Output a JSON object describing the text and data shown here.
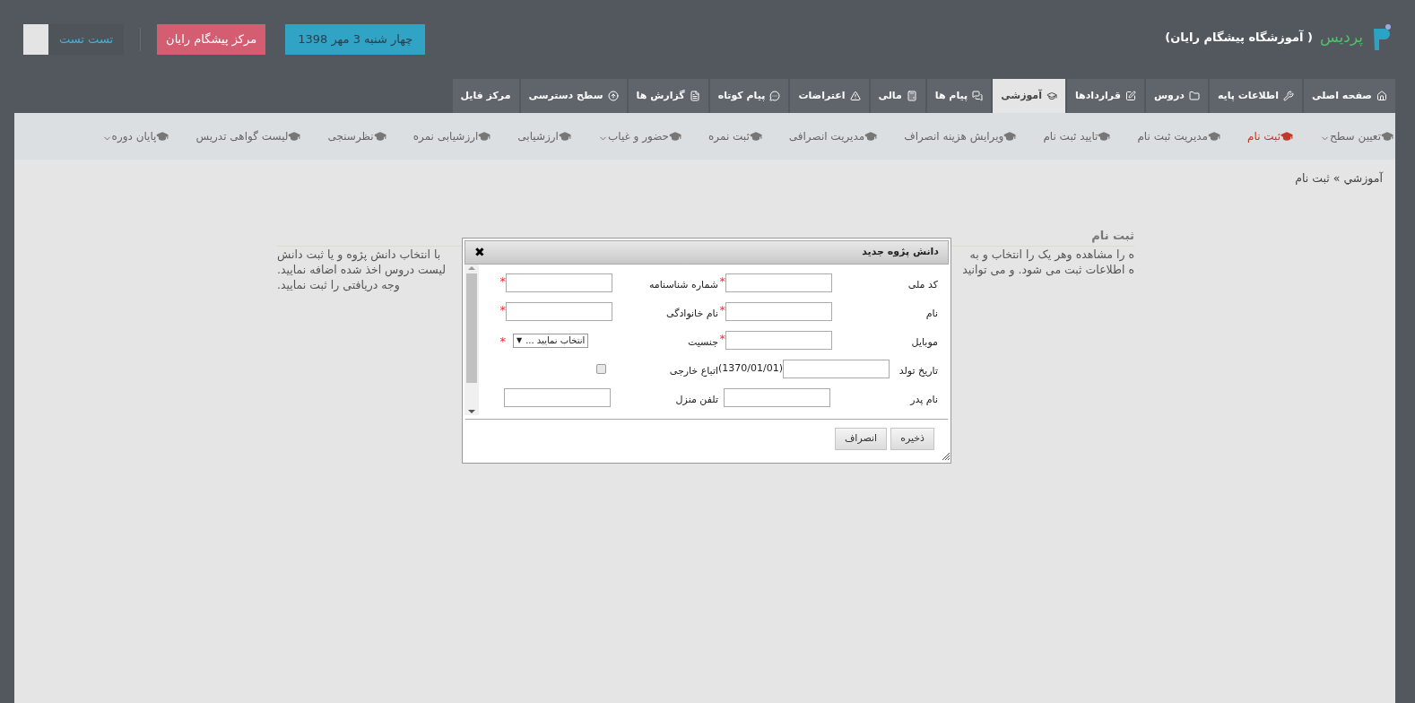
{
  "header": {
    "brand": "پردیس",
    "institute": "( آموزشگاه پیشگام رایان)",
    "date_badge": "چهار شنبه 3 مهر 1398",
    "center_badge": "مرکز پیشگام رایان",
    "user_name": "تست تست"
  },
  "tabs": [
    {
      "label": "صفحه اصلی",
      "selected": false
    },
    {
      "label": "اطلاعات پایه",
      "selected": false
    },
    {
      "label": "دروس",
      "selected": false
    },
    {
      "label": "قراردادها",
      "selected": false
    },
    {
      "label": "آموزشی",
      "selected": true
    },
    {
      "label": "پیام ها",
      "selected": false
    },
    {
      "label": "مالی",
      "selected": false
    },
    {
      "label": "اعتراضات",
      "selected": false
    },
    {
      "label": "پیام کوتاه",
      "selected": false
    },
    {
      "label": "گزارش ها",
      "selected": false
    },
    {
      "label": "سطح دسترسی",
      "selected": false
    },
    {
      "label": "مرکز فایل",
      "selected": false
    }
  ],
  "subnav": [
    {
      "label": "تعیین سطح",
      "selected": false,
      "dropdown": true
    },
    {
      "label": "ثبت نام",
      "selected": true,
      "dropdown": false
    },
    {
      "label": "مدیریت ثبت نام",
      "selected": false,
      "dropdown": false
    },
    {
      "label": "تایید ثبت نام",
      "selected": false,
      "dropdown": false
    },
    {
      "label": "ویرایش هزینه انصراف",
      "selected": false,
      "dropdown": false
    },
    {
      "label": "مدیریت انصرافی",
      "selected": false,
      "dropdown": false
    },
    {
      "label": "ثبت نمره",
      "selected": false,
      "dropdown": false
    },
    {
      "label": "حضور و غیاب",
      "selected": false,
      "dropdown": true
    },
    {
      "label": "ارزشیابی",
      "selected": false,
      "dropdown": false
    },
    {
      "label": "ارزشیابی نمره",
      "selected": false,
      "dropdown": false
    },
    {
      "label": "نظرسنجی",
      "selected": false,
      "dropdown": false
    },
    {
      "label": "لیست گواهی تدریس",
      "selected": false,
      "dropdown": false
    },
    {
      "label": "پایان دوره",
      "selected": false,
      "dropdown": true
    }
  ],
  "breadcrumb": "آموزشي » ثبت نام",
  "section": {
    "title": "ثبت نام",
    "lines": [
      {
        "left": "با انتخاب دانش پژوه و یا ثبت دانش",
        "right": "ه را مشاهده وهر یک را انتخاب و به"
      },
      {
        "left": "لیست دروس اخذ شده اضافه نمایید.",
        "right": "ه اطلاعات ثبت می شود. و می توانید"
      },
      {
        "left": "وجه دریافتی را ثبت نمایید."
      }
    ]
  },
  "dialog": {
    "title": "دانش پژوه جدید",
    "close": "✖",
    "required_mark": "*",
    "select_arrow": "▼",
    "rows": [
      [
        {
          "label": "کد ملی",
          "kind": "text",
          "required": true
        },
        {
          "label": "شماره شناسنامه",
          "kind": "text",
          "required": true
        }
      ],
      [
        {
          "label": "نام",
          "kind": "text",
          "required": true
        },
        {
          "label": "نام خانوادگی",
          "kind": "text",
          "required": true
        }
      ],
      [
        {
          "label": "موبایل",
          "kind": "text",
          "required": true
        },
        {
          "label": "جنسیت",
          "kind": "select",
          "value": "انتخاب نمایید ...",
          "required": true
        }
      ],
      [
        {
          "label": "تاریخ تولد",
          "kind": "date",
          "hint": "(1370/01/01)",
          "required": false
        },
        {
          "label": "اتباع خارجی",
          "kind": "checkbox",
          "checked": false,
          "required": false
        }
      ],
      [
        {
          "label": "نام پدر",
          "kind": "text",
          "required": false
        },
        {
          "label": "تلفن منزل",
          "kind": "text",
          "required": false
        }
      ]
    ],
    "buttons": [
      "ذخیره",
      "انصراف"
    ]
  }
}
